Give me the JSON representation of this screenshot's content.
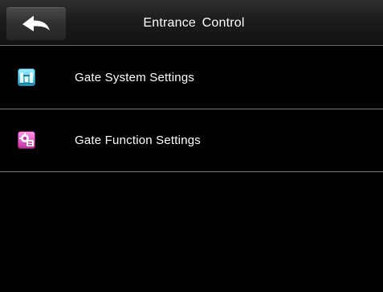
{
  "header": {
    "title": "Entrance  Control",
    "back_icon": "back-arrow-icon"
  },
  "menu": {
    "items": [
      {
        "label": "Gate System Settings",
        "icon": "gate-system-icon",
        "icon_colors": [
          "#3fb6d8",
          "#8fe0f0"
        ]
      },
      {
        "label": "Gate Function Settings",
        "icon": "gate-function-icon",
        "icon_colors": [
          "#d040b8",
          "#f28ee0"
        ]
      }
    ]
  },
  "colors": {
    "background": "#000000",
    "text": "#ffffff",
    "divider": "#7a7a7a"
  }
}
